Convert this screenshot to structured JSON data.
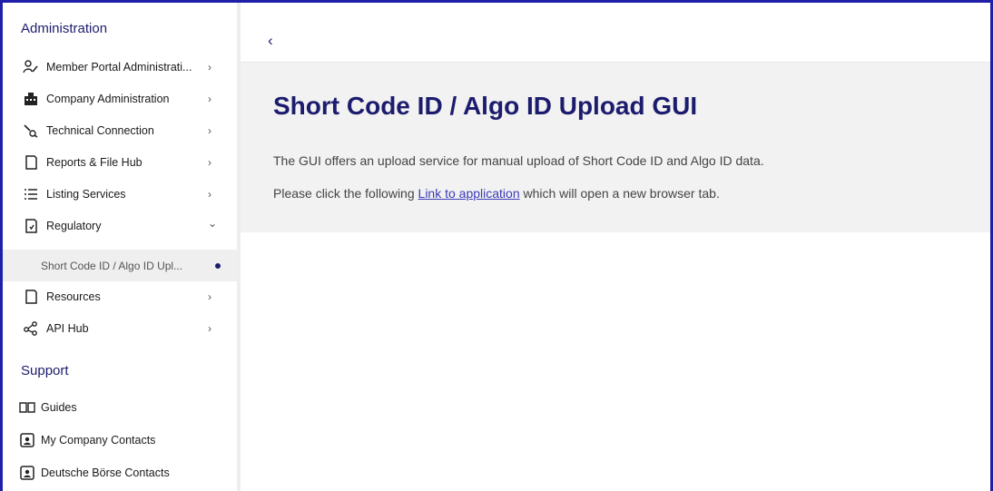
{
  "sidebar": {
    "admin_title": "Administration",
    "items": [
      {
        "label": "Member Portal Administrati...",
        "icon": "user-edit-icon",
        "chevron": "›"
      },
      {
        "label": "Company Administration",
        "icon": "building-icon",
        "chevron": "›"
      },
      {
        "label": "Technical Connection",
        "icon": "connection-icon",
        "chevron": "›"
      },
      {
        "label": "Reports & File Hub",
        "icon": "file-icon",
        "chevron": "›"
      },
      {
        "label": "Listing Services",
        "icon": "list-icon",
        "chevron": "›"
      },
      {
        "label": "Regulatory",
        "icon": "regulatory-icon",
        "chevron": "⌄"
      },
      {
        "label": "Short Code ID / Algo ID Upl...",
        "active": true
      },
      {
        "label": "Resources",
        "icon": "file-icon",
        "chevron": "›"
      },
      {
        "label": "API Hub",
        "icon": "share-icon",
        "chevron": "›"
      }
    ],
    "support_title": "Support",
    "support_items": [
      {
        "label": "Guides",
        "icon": "book-icon"
      },
      {
        "label": "My Company Contacts",
        "icon": "contact-card-icon"
      },
      {
        "label": "Deutsche Börse Contacts",
        "icon": "contact-card-icon"
      }
    ]
  },
  "header": {
    "back": "‹"
  },
  "main": {
    "title": "Short Code ID / Algo ID Upload GUI",
    "description": "The GUI offers an upload service for manual upload of Short Code ID and Algo ID data.",
    "link_prefix": "Please click the following ",
    "link_text": "Link to application",
    "link_suffix": " which will open a new browser tab."
  },
  "colors": {
    "accent": "#1c1c6e",
    "frame": "#1f1fa8",
    "link": "#3a3ab8"
  }
}
